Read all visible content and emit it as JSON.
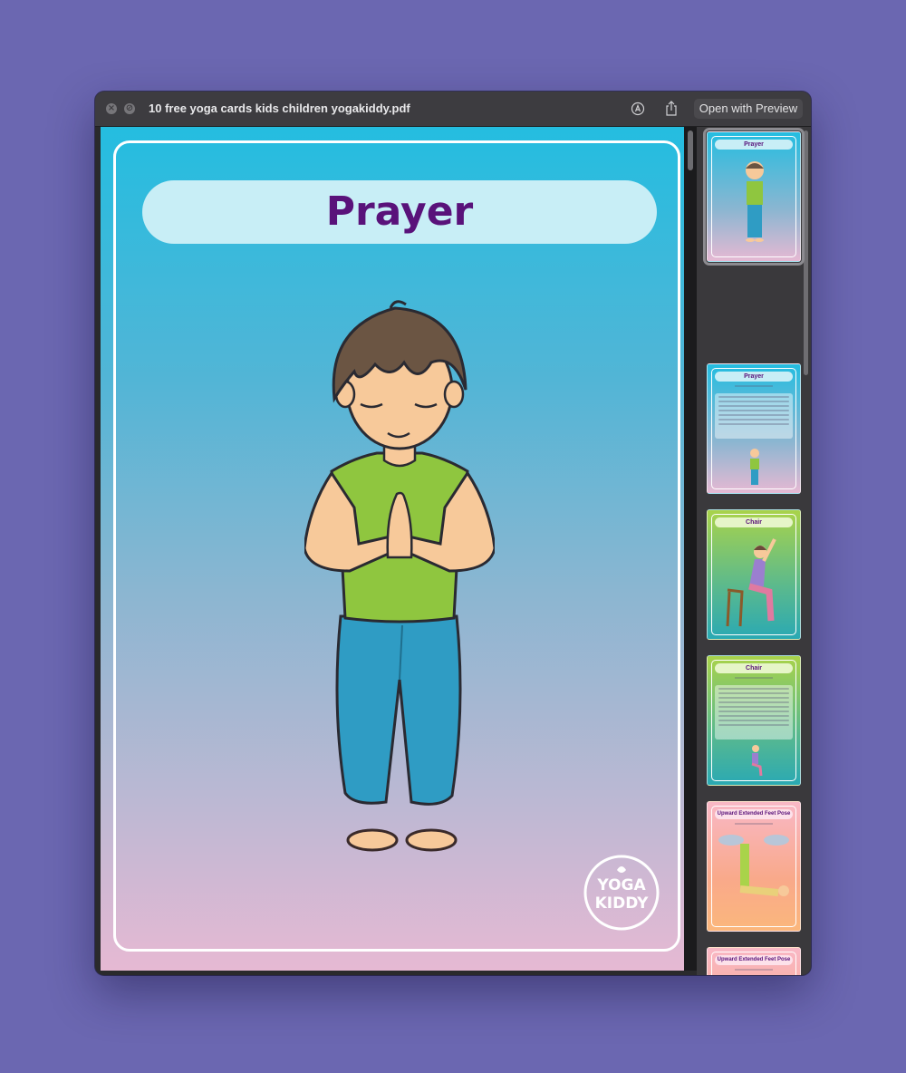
{
  "window": {
    "title": "10 free yoga cards kids children yogakiddy.pdf",
    "open_button_label": "Open with Preview",
    "close_icon": "close-icon",
    "minimize_icon": "minimize-icon",
    "markup_icon": "markup-icon",
    "share_icon": "share-icon"
  },
  "page": {
    "card_title": "Prayer",
    "logo_text": [
      "YOGA",
      "KIDDY"
    ]
  },
  "thumbnails": [
    {
      "title": "Prayer",
      "type": "image",
      "selected": true
    },
    {
      "title": "Prayer",
      "type": "text",
      "selected": false
    },
    {
      "title": "Chair",
      "type": "image",
      "selected": false
    },
    {
      "title": "Chair",
      "type": "text",
      "selected": false
    },
    {
      "title": "Upward Extended Feet Pose",
      "type": "image",
      "selected": false
    },
    {
      "title": "Upward Extended Feet Pose",
      "type": "text",
      "selected": false
    }
  ],
  "colors": {
    "desktop": "#6b67b1",
    "title_text": "#59127a",
    "title_pill": "#c8eef6",
    "card_top": "#24bde0",
    "card_bottom": "#e6b9d3"
  }
}
